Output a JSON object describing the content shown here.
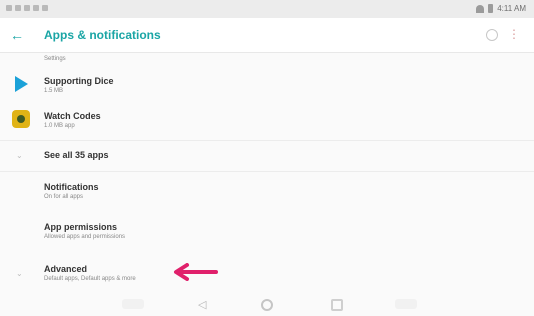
{
  "status_bar": {
    "time": "4:11 AM"
  },
  "app_bar": {
    "title": "Apps & notifications"
  },
  "list": {
    "top_sub": "Settings",
    "items": [
      {
        "title": "Supporting Dice",
        "subtitle": "1.5 MB"
      },
      {
        "title": "Watch Codes",
        "subtitle": "1.0 MB app"
      },
      {
        "title": "See all 35 apps"
      },
      {
        "title": "Notifications",
        "subtitle": "On for all apps"
      },
      {
        "title": "App permissions",
        "subtitle": "Allowed apps and permissions"
      },
      {
        "title": "Advanced",
        "subtitle": "Default apps, Default apps & more"
      }
    ]
  },
  "colors": {
    "accent": "#1aa5a5",
    "arrow": "#e0206b"
  }
}
